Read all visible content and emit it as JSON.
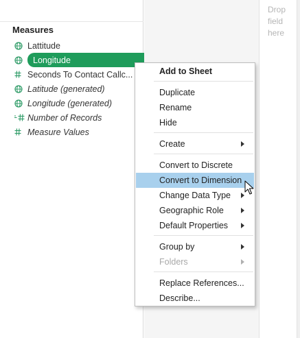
{
  "drop_hint": [
    "Drop",
    "field",
    "here"
  ],
  "measures": {
    "title": "Measures",
    "fields": [
      {
        "label": "Lattitude",
        "icon": "globe-icon",
        "italic": false,
        "selected": false
      },
      {
        "label": "Longitude",
        "icon": "globe-icon",
        "italic": false,
        "selected": true
      },
      {
        "label": "Seconds To Contact Callc...",
        "icon": "hash-icon",
        "italic": false,
        "selected": false
      },
      {
        "label": "Latitude (generated)",
        "icon": "globe-icon",
        "italic": true,
        "selected": false
      },
      {
        "label": "Longitude (generated)",
        "icon": "globe-icon",
        "italic": true,
        "selected": false
      },
      {
        "label": "Number of Records",
        "icon": "calculated-hash-icon",
        "italic": true,
        "selected": false
      },
      {
        "label": "Measure Values",
        "icon": "hash-icon",
        "italic": true,
        "selected": false
      }
    ]
  },
  "context_menu": {
    "items": [
      {
        "label": "Add to Sheet",
        "bold": true
      },
      {
        "label": "Duplicate"
      },
      {
        "label": "Rename"
      },
      {
        "label": "Hide"
      },
      {
        "label": "Create",
        "submenu": true
      },
      {
        "label": "Convert to Discrete"
      },
      {
        "label": "Convert to Dimension",
        "hovered": true
      },
      {
        "label": "Change Data Type",
        "submenu": true
      },
      {
        "label": "Geographic Role",
        "submenu": true
      },
      {
        "label": "Default Properties",
        "submenu": true
      },
      {
        "label": "Group by",
        "submenu": true
      },
      {
        "label": "Folders",
        "submenu": true,
        "disabled": true
      },
      {
        "label": "Replace References..."
      },
      {
        "label": "Describe..."
      }
    ]
  },
  "colors": {
    "selected_pill": "#1f9c5b",
    "icon_green": "#2c9a65",
    "menu_hover": "#a8d0ed"
  }
}
